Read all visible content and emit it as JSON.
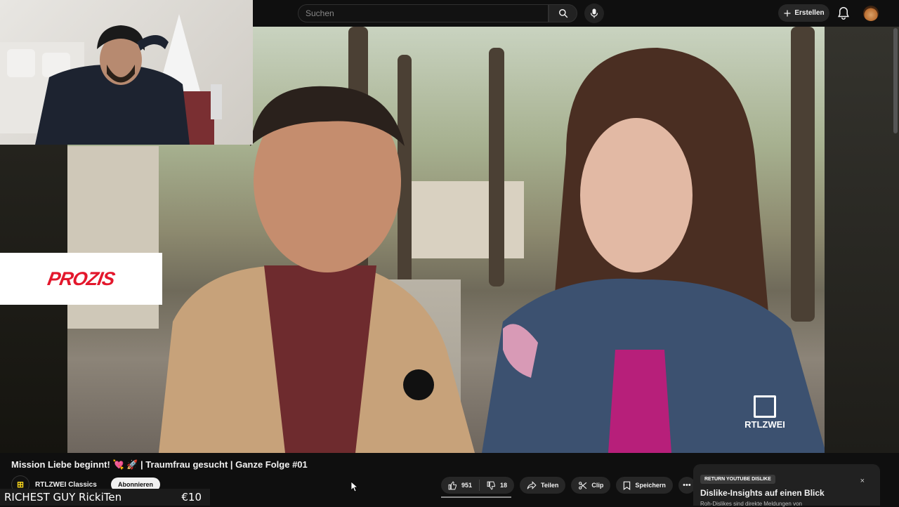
{
  "header": {
    "search_placeholder": "Suchen",
    "create_label": "Erstellen"
  },
  "icons": [
    "search-icon",
    "mic-icon",
    "plus-icon",
    "bell-icon",
    "like-icon",
    "dislike-icon",
    "share-icon",
    "clip-icon",
    "save-icon",
    "more-icon",
    "close-icon"
  ],
  "overlay": {
    "sponsor_text": "PROZIS",
    "ticker_name": "RICHEST GUY RickiTen",
    "ticker_amount": "€10",
    "watermark": "RTLZWEI"
  },
  "video": {
    "title": "Mission Liebe beginnt! 💘 🚀 | Traumfrau gesucht | Ganze Folge #01",
    "channel": "RTLZWEI Classics",
    "subscribe_label": "Abonnieren"
  },
  "actions": {
    "likes": "951",
    "dislikes": "18",
    "share": "Teilen",
    "clip": "Clip",
    "save": "Speichern"
  },
  "rd_panel": {
    "badge": "RETURN YOUTUBE DISLIKE",
    "title": "Dislike-Insights auf einen Blick",
    "subtitle": "Roh-Dislikes sind direkte Meldungen von",
    "close": "×"
  },
  "colors": {
    "background": "#0f0f0f",
    "sponsor_red": "#e3172c",
    "pill": "#272727"
  }
}
